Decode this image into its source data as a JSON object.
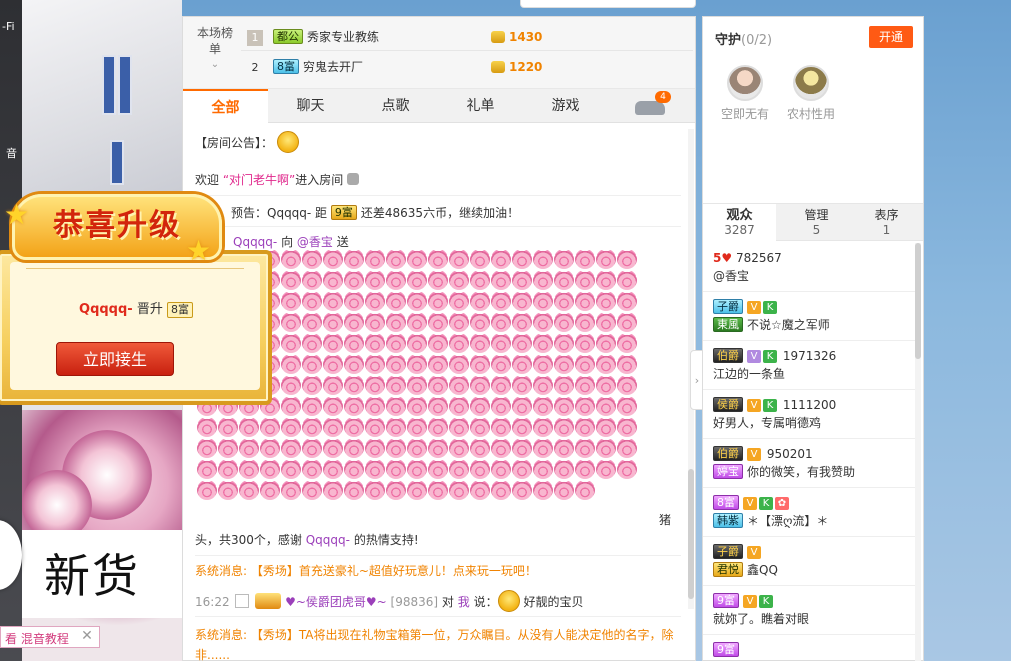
{
  "video": {
    "side_text": [
      "-Fi",
      "音"
    ],
    "new_goods": "新货",
    "bottom_tab": "看 混音教程",
    "bottom_close": "✕"
  },
  "levelup": {
    "banner": "恭喜升级",
    "user": "Qqqqq-",
    "verb": "晋升",
    "level": "8富",
    "accept": "立即接生"
  },
  "rank": {
    "title": "本场榜单",
    "rows": [
      {
        "num": "1",
        "tag": "都公",
        "name": "秀家专业教练",
        "value": "1430"
      },
      {
        "num": "2",
        "tag": "8富",
        "name": "穷鬼去开厂",
        "value": "1220"
      }
    ]
  },
  "tabs": [
    "全部",
    "聊天",
    "点歌",
    "礼单",
    "游戏"
  ],
  "car_badge": "4",
  "messages": {
    "notice": "【房间公告】：",
    "welcome_pre": "欢迎 ",
    "welcome_name": "“对门老牛啊”",
    "welcome_post": "进入房间",
    "upgrade_prefix": "预告：Qqqqq- 距",
    "upgrade_badge": "9富",
    "upgrade_rest": "还差48635六币，继续加油！",
    "gift_from": "Qqqqq-",
    "gift_to_word": "向",
    "gift_to": "@香宝",
    "gift_send": "送",
    "gift_tail_a": "猪",
    "gift_tail_b": "头，共300个，感谢",
    "gift_thanks_name": "Qqqqq-",
    "gift_tail_c": "的热情支持!",
    "sys1_label": "系统消息:",
    "sys1_text": "【秀场】首充送豪礼~超值好玩意儿！点来玩一玩吧！",
    "chat_time": "16:22",
    "chat_name": "♥~侯爵团虎哥♥~",
    "chat_id": "[98836]",
    "chat_to": "对",
    "chat_me": "我",
    "chat_say": "说：",
    "chat_text": "好靓的宝贝",
    "sys2_label": "系统消息:",
    "sys2_text": "【秀场】TA将出现在礼物宝箱第一位，万众瞩目。从没有人能决定他的名字，除非......"
  },
  "guard": {
    "title": "守护",
    "count": "(0/2)",
    "open": "开通",
    "slots": [
      "空即无有",
      "农村性用"
    ]
  },
  "audience_tabs": [
    {
      "label": "观众",
      "n": "3287"
    },
    {
      "label": "管理",
      "n": "5"
    },
    {
      "label": "表序",
      "n": "1"
    }
  ],
  "audience": [
    {
      "level": "5♥",
      "id": "782567",
      "name": "@香宝"
    },
    {
      "tag": "子爵",
      "badges": [
        "V",
        "K"
      ],
      "fan": "東風",
      "name": "不说☆魔之军师"
    },
    {
      "tag": "伯爵",
      "badges": [
        "V",
        "K"
      ],
      "id": "1971326",
      "name": "江边的一条鱼"
    },
    {
      "tag": "侯爵",
      "badges": [
        "V",
        "K"
      ],
      "id": "1111200",
      "name": "好男人，专属哨德鸡"
    },
    {
      "tag": "伯爵",
      "badges": [
        "V"
      ],
      "id": "950201",
      "fan": "婷宝",
      "name": "你的微笑，有我赞助"
    },
    {
      "tag": "8富",
      "badges": [
        "V",
        "K",
        "✿"
      ],
      "fan": "韩紫",
      "name": "＊【漂ღ流】＊"
    },
    {
      "tag": "子爵",
      "badges": [
        "V"
      ],
      "fan": "君悦",
      "name": "鑫QQ"
    },
    {
      "tag": "9富",
      "badges": [
        "V",
        "K"
      ],
      "name": "就妳了。瞧着对眼"
    },
    {
      "tag": "9富",
      "badges": [],
      "name": ""
    }
  ],
  "colors": {
    "accent": "#ff6a00",
    "sys": "#f08300",
    "name": "#9b3fba",
    "highlight": "#e0288c"
  },
  "pig_count": 250
}
